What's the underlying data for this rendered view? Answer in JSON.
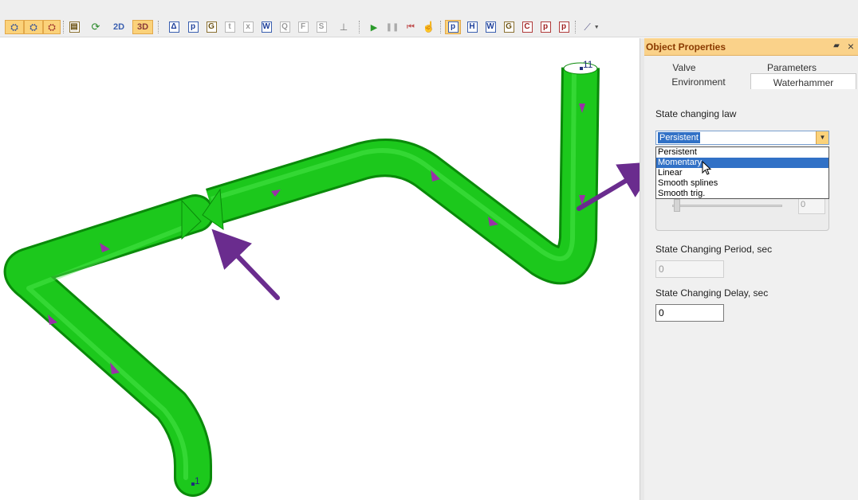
{
  "toolbar": {
    "mode_2d": "2D",
    "mode_3d": "3D"
  },
  "canvas": {
    "node_start_label": "1",
    "node_end_label": "11",
    "pipe_color": "#1cc81c",
    "arrow_color": "#9a2fa8",
    "annotation_color": "#6a2c8e"
  },
  "panel": {
    "title": "Object Properties",
    "tabs": [
      "Valve",
      "Parameters Selection",
      "Environment",
      "Waterhammer"
    ],
    "active_tab": "Waterhammer",
    "state_law_label": "State changing law",
    "state_law_value": "Persistent",
    "state_law_options": [
      "Persistent",
      "Momentary",
      "Linear",
      "Smooth splines",
      "Smooth trig."
    ],
    "highlighted_option": "Momentary",
    "slider_value": "0",
    "period_label": "State Changing Period, sec",
    "period_value": "0",
    "delay_label": "State Changing Delay, sec",
    "delay_value": "0"
  }
}
